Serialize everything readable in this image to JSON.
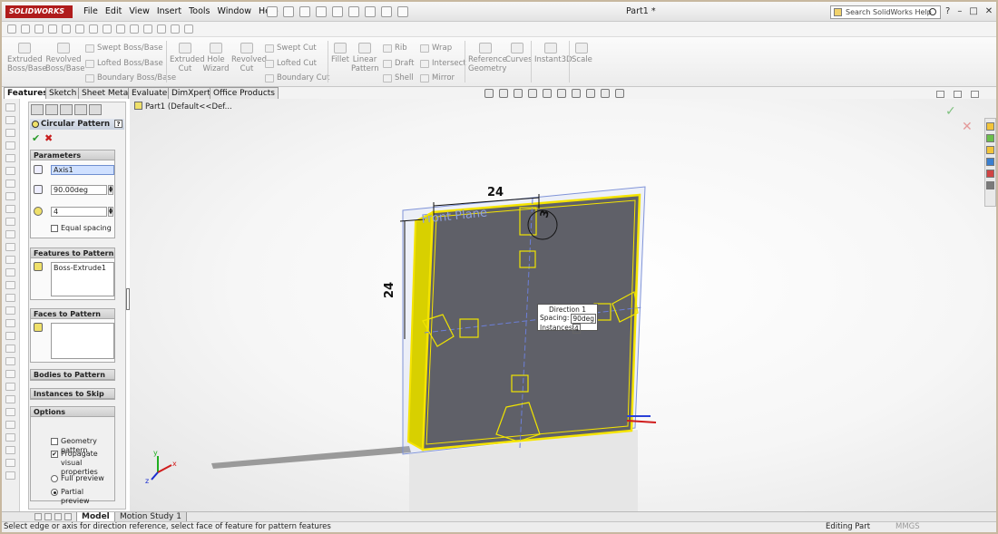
{
  "app": {
    "logo": "SOLIDWORKS",
    "doc_title": "Part1 *"
  },
  "menu": [
    "File",
    "Edit",
    "View",
    "Insert",
    "Tools",
    "Window",
    "Help"
  ],
  "search": {
    "placeholder": "Search SolidWorks Help"
  },
  "ribbon": {
    "extruded_boss": "Extruded Boss/Base",
    "revolved_boss": "Revolved Boss/Base",
    "swept_boss": "Swept Boss/Base",
    "lofted_boss": "Lofted Boss/Base",
    "boundary_boss": "Boundary Boss/Base",
    "extruded_cut": "Extruded Cut",
    "hole_wizard": "Hole Wizard",
    "revolved_cut": "Revolved Cut",
    "swept_cut": "Swept Cut",
    "lofted_cut": "Lofted Cut",
    "boundary_cut": "Boundary Cut",
    "fillet": "Fillet",
    "linear_pattern": "Linear Pattern",
    "rib": "Rib",
    "draft": "Draft",
    "shell": "Shell",
    "wrap": "Wrap",
    "intersect": "Intersect",
    "mirror": "Mirror",
    "reference_geometry": "Reference Geometry",
    "curves": "Curves",
    "instant3d": "Instant3D",
    "scale": "Scale"
  },
  "cm_tabs": [
    "Features",
    "Sketch",
    "Sheet Metal",
    "Evaluate",
    "DimXpert",
    "Office Products"
  ],
  "pm": {
    "title": "Circular Pattern",
    "help": "?",
    "parameters": {
      "header": "Parameters",
      "axis": "Axis1",
      "angle": "90.00deg",
      "instances": "4",
      "equal_spacing": "Equal spacing"
    },
    "features_to_pattern": {
      "header": "Features to Pattern",
      "item": "Boss-Extrude1"
    },
    "faces_to_pattern": {
      "header": "Faces to Pattern"
    },
    "bodies_to_pattern": {
      "header": "Bodies to Pattern"
    },
    "instances_to_skip": {
      "header": "Instances to Skip"
    },
    "options": {
      "header": "Options",
      "geometry_pattern": "Geometry pattern",
      "propagate": "Propagate visual properties",
      "full_preview": "Full preview",
      "partial_preview": "Partial preview"
    }
  },
  "tree": {
    "root": "Part1  (Default<<Def..."
  },
  "viewport": {
    "plane_label": "Front Plane",
    "dim_top": "24",
    "dim_left": "24",
    "dim_small": "3",
    "callout": {
      "title": "Direction 1",
      "spacing_label": "Spacing:",
      "spacing_value": "90deg",
      "instances_label": "Instances:",
      "instances_value": "4"
    },
    "triad_z": "z",
    "triad_y": "y",
    "triad_x": "x"
  },
  "bottom_tabs": [
    "Model",
    "Motion Study 1"
  ],
  "status": {
    "message": "Select edge or axis for direction reference, select face of feature for pattern features",
    "mode": "Editing Part",
    "units": "MMGS"
  },
  "colors": {
    "accent": "#b01c1c",
    "edge_highlight": "#f5e400",
    "plate": "#5f6068",
    "plane": "#7f93d8"
  }
}
